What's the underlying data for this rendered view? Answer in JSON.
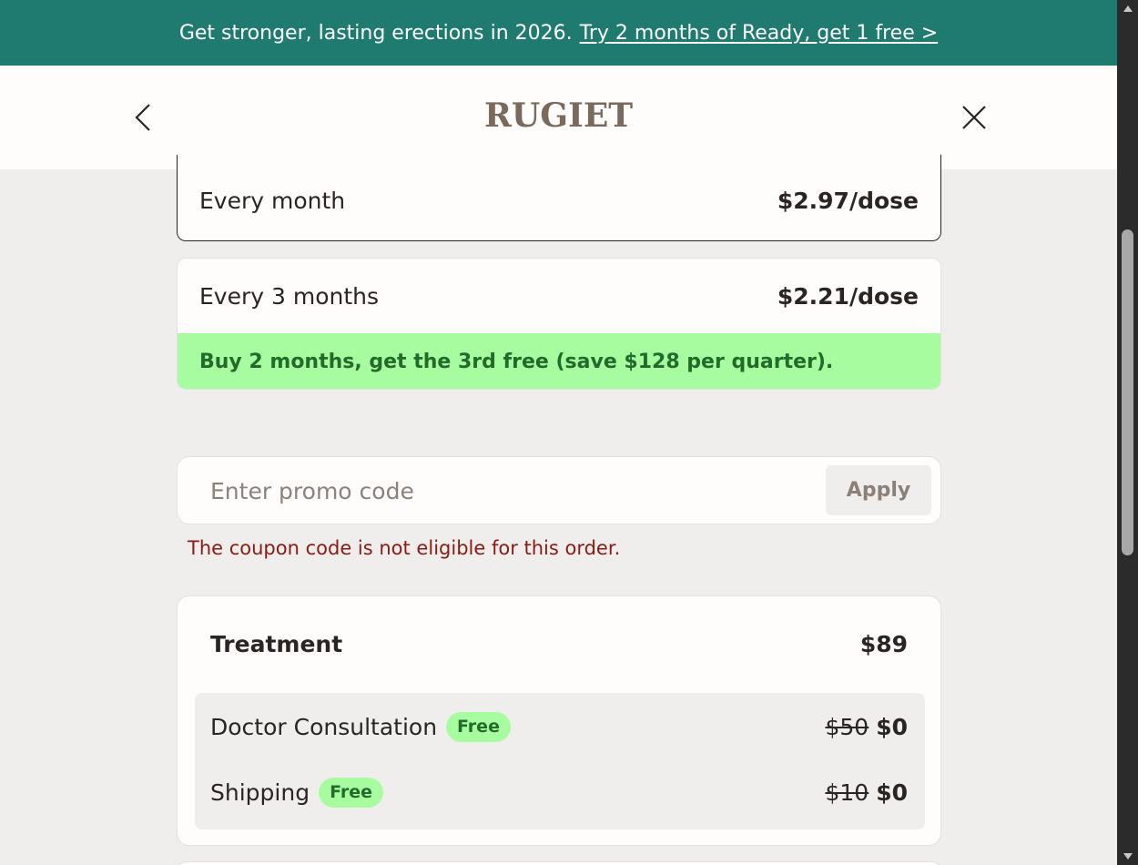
{
  "banner": {
    "text": "Get stronger, lasting erections in 2026.",
    "link": "Try 2 months of Ready, get 1 free >"
  },
  "header": {
    "logo": "RUGIET",
    "back_icon": "chevron-left-icon",
    "close_icon": "close-icon"
  },
  "plans": [
    {
      "label": "Every month",
      "price": "$2.97/dose",
      "selected": true
    },
    {
      "label": "Every 3 months",
      "price": "$2.21/dose",
      "promo": "Buy 2 months, get the 3rd free (save $128 per quarter)."
    }
  ],
  "coupon": {
    "placeholder": "Enter promo code",
    "value": "",
    "apply_label": "Apply",
    "error": "The coupon code is not eligible for this order."
  },
  "summary": {
    "title": "Treatment",
    "total": "$89",
    "items": [
      {
        "label": "Doctor Consultation",
        "badge": "Free",
        "old_price": "$50",
        "price": "$0"
      },
      {
        "label": "Shipping",
        "badge": "Free",
        "old_price": "$10",
        "price": "$0"
      }
    ]
  },
  "colors": {
    "banner": "#1f7a70",
    "promo_green": "#a8fca0",
    "error_red": "#8b1a14",
    "logo": "#7a6a5e"
  }
}
